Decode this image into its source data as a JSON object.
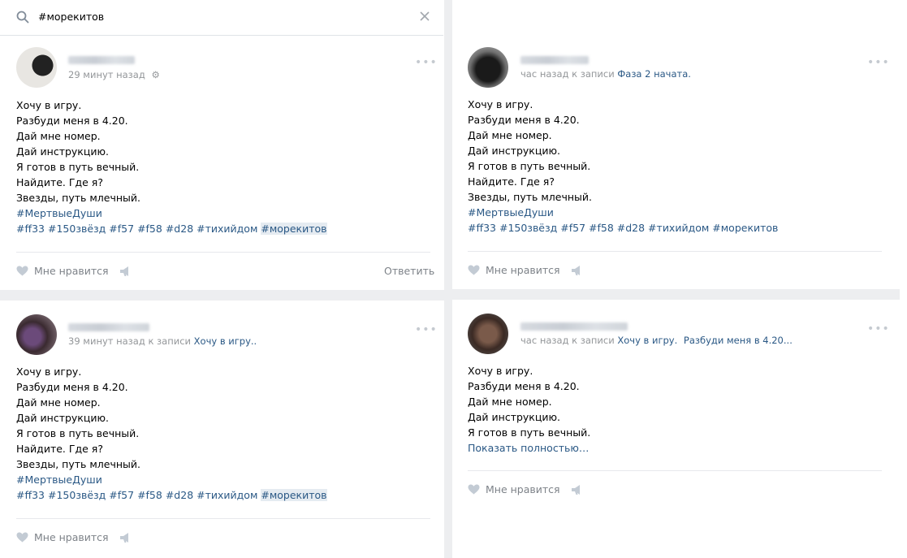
{
  "search": {
    "query": "#морекитов"
  },
  "colors": {
    "link": "#2a5885",
    "meta": "#939699",
    "gap": "#edeef0",
    "accent_bg": "#e5ebf1"
  },
  "posts": [
    {
      "meta_time": "29 минут назад",
      "lines": [
        "Хочу в игру.",
        "Разбуди меня в 4.20.",
        "Дай мне номер.",
        "Дай инструкцию.",
        "Я готов в путь вечный.",
        "Найдите. Где я?",
        "Звезды, путь млечный."
      ],
      "hashtag_line1": "#МертвыеДуши",
      "tags": [
        "#ff33",
        "#150звёзд",
        "#f57",
        "#f58",
        "#d28",
        "#тихийдом"
      ],
      "highlight_tag": "#морекитов",
      "like_label": "Мне нравится",
      "reply_label": "Ответить"
    },
    {
      "meta_time": "час назад к записи",
      "meta_ref": "Фаза 2 начата.",
      "lines": [
        "Хочу в игру.",
        "Разбуди меня в 4.20.",
        "Дай мне номер.",
        "Дай инструкцию.",
        "Я готов в путь вечный.",
        "Найдите. Где я?",
        "Звезды, путь млечный."
      ],
      "hashtag_line1": "#МертвыеДуши",
      "tags_line": "#ff33 #150звёзд #f57 #f58 #d28 #тихийдом #морекитов",
      "like_label": "Мне нравится"
    },
    {
      "meta_time": "39 минут назад к записи",
      "meta_ref": "Хочу в игру..",
      "lines": [
        "Хочу в игру.",
        "Разбуди меня в 4.20.",
        "Дай мне номер.",
        "Дай инструкцию.",
        "Я готов в путь вечный.",
        "Найдите. Где я?",
        "Звезды, путь млечный."
      ],
      "hashtag_line1": "#МертвыеДуши",
      "tags": [
        "#ff33",
        "#150звёзд",
        "#f57",
        "#f58",
        "#d28",
        "#тихийдом"
      ],
      "highlight_tag": "#морекитов",
      "like_label": "Мне нравится"
    },
    {
      "meta_time": "час назад к записи",
      "meta_ref": "Хочу в игру.",
      "meta_ref2": "Разбуди меня в 4.20...",
      "lines": [
        "Хочу в игру.",
        "Разбуди меня в 4.20.",
        "Дай мне номер.",
        "Дай инструкцию.",
        "Я готов в путь вечный."
      ],
      "more_label": "Показать полностью…",
      "like_label": "Мне нравится"
    }
  ]
}
